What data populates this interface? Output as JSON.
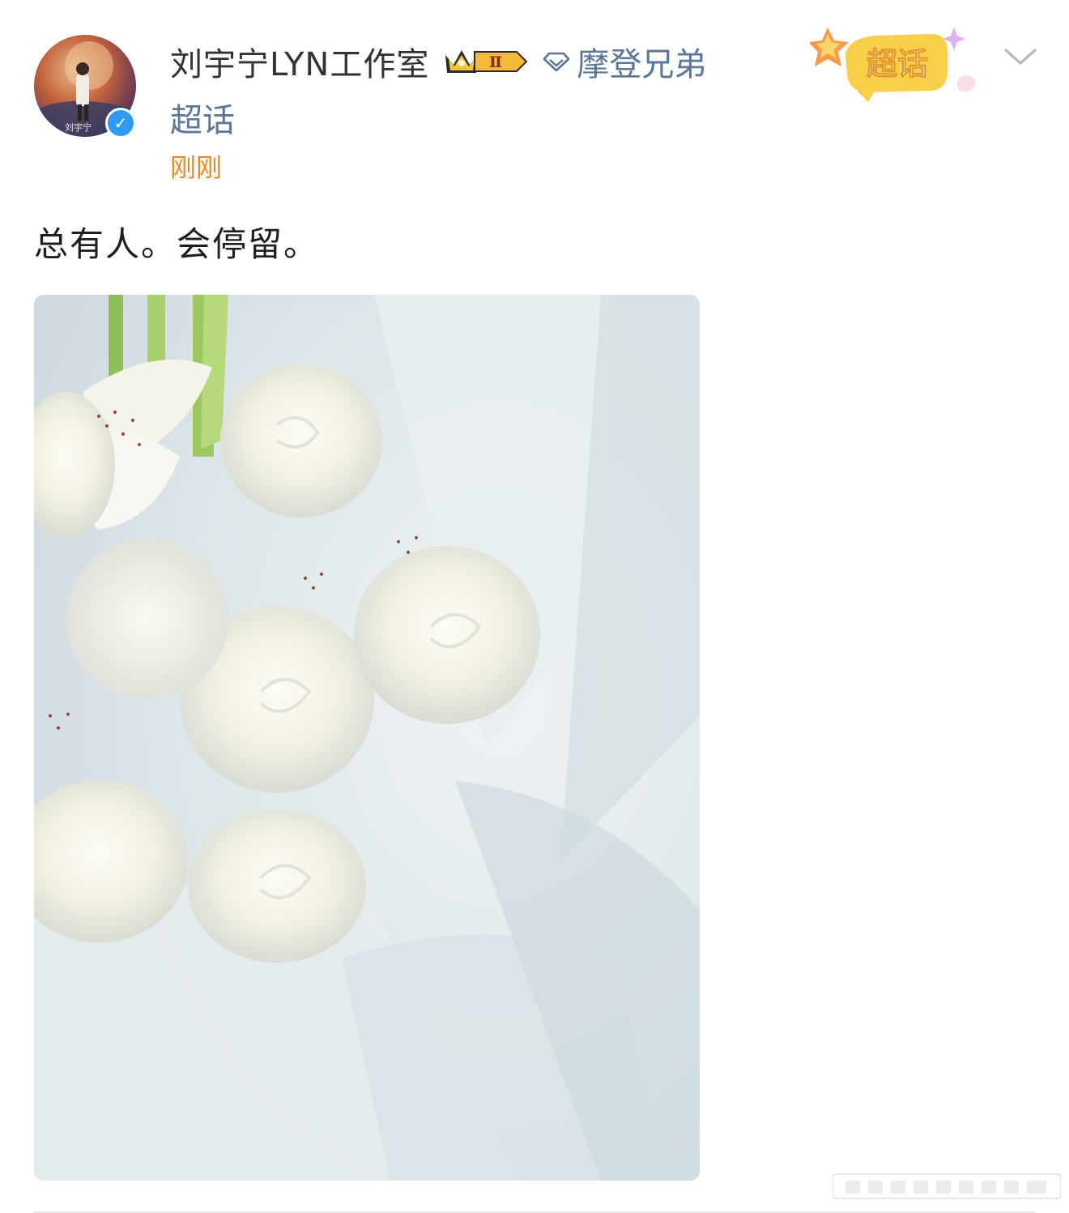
{
  "post": {
    "author": {
      "name": "刘宇宁LYN工作室",
      "avatar_caption": "刘宇宁",
      "verified_icon": "blue-v-verified-icon",
      "level_badge": "Ⅱ"
    },
    "fan_topic": {
      "icon": "diamond-icon",
      "label": "摩登兄弟",
      "suffix": "超话"
    },
    "timestamp": "刚刚",
    "sticker_label": "超话",
    "text": "总有人。会停留。",
    "image": {
      "subject": "white-flower-bouquet"
    }
  },
  "colors": {
    "link_blue": "#5b7697",
    "time_orange": "#e8862a",
    "verified_blue": "#2e9bf0",
    "sticker_yellow": "#f7cf4a"
  }
}
